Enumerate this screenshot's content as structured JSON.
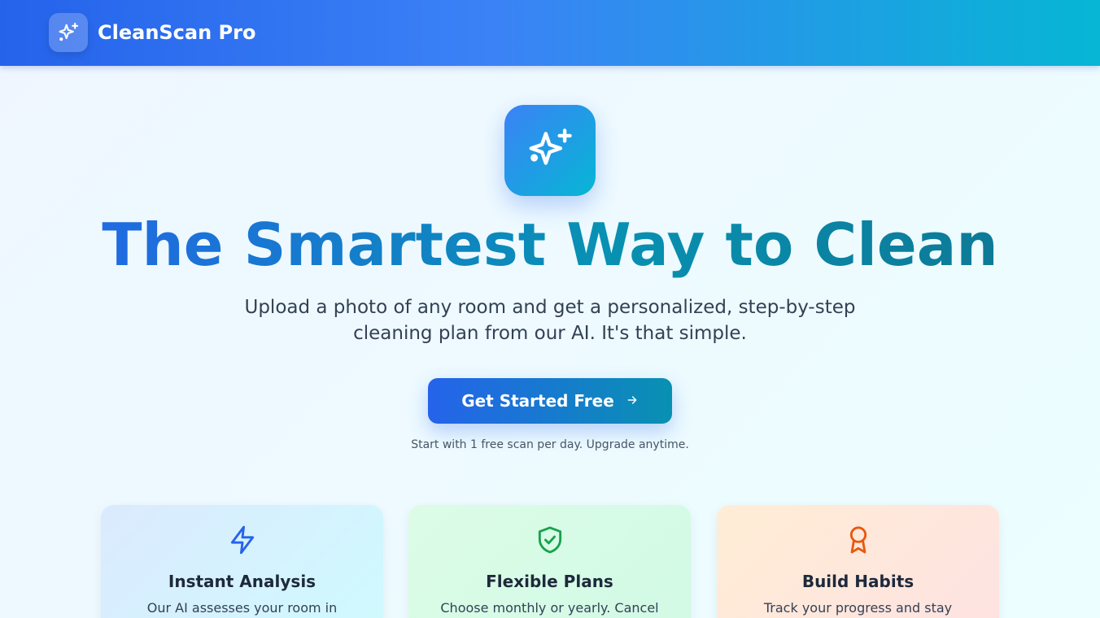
{
  "header": {
    "brand_name": "CleanScan Pro",
    "logo_icon": "sparkles-icon"
  },
  "hero": {
    "icon": "sparkles-icon",
    "title": "The Smartest Way to Clean",
    "subtitle": "Upload a photo of any room and get a personalized, step-by-step cleaning plan from our AI. It's that simple.",
    "cta_label": "Get Started Free",
    "cta_icon": "arrow-right-icon",
    "cta_note": "Start with 1 free scan per day. Upgrade anytime."
  },
  "features": [
    {
      "icon": "lightning-icon",
      "title": "Instant Analysis",
      "text": "Our AI assesses your room in",
      "color": "#2563eb"
    },
    {
      "icon": "shield-check-icon",
      "title": "Flexible Plans",
      "text": "Choose monthly or yearly. Cancel",
      "color": "#16a34a"
    },
    {
      "icon": "award-icon",
      "title": "Build Habits",
      "text": "Track your progress and stay",
      "color": "#ea580c"
    }
  ],
  "colors": {
    "primary": "#2563eb",
    "accent": "#06b6d4"
  }
}
